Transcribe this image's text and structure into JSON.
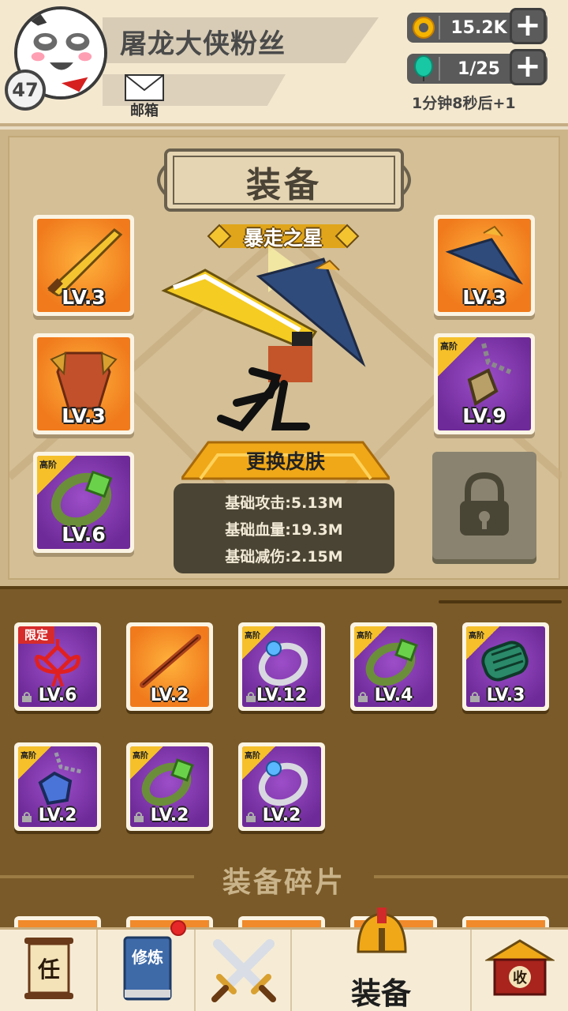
{
  "player": {
    "name": "屠龙大侠粉丝",
    "level": "47",
    "mail_label": "邮箱"
  },
  "resources": {
    "coins": "15.2K",
    "energy": "1/25",
    "energy_timer": "1分钟8秒后+1"
  },
  "equipment": {
    "title": "装备",
    "skin_name": "暴走之星",
    "change_skin_label": "更换皮肤",
    "slots": [
      {
        "item": "golden-sword",
        "level": "LV.3",
        "tier": ""
      },
      {
        "item": "straw-hat",
        "level": "LV.3",
        "tier": ""
      },
      {
        "item": "armor",
        "level": "LV.3",
        "tier": ""
      },
      {
        "item": "amulet",
        "level": "LV.9",
        "tier": "高阶"
      },
      {
        "item": "jade-ring",
        "level": "LV.6",
        "tier": "高阶"
      }
    ],
    "stats": [
      "基础攻击:5.13M",
      "基础血量:19.3M",
      "基础减伤:2.15M"
    ]
  },
  "inventory": {
    "items": [
      {
        "item": "chinese-knot",
        "level": "LV.6",
        "tag": "限定",
        "bg": "purple"
      },
      {
        "item": "staff",
        "level": "LV.2",
        "tag": "",
        "bg": "orange"
      },
      {
        "item": "silver-ring",
        "level": "LV.12",
        "tag": "高阶",
        "bg": "purple"
      },
      {
        "item": "jade-ring",
        "level": "LV.4",
        "tag": "高阶",
        "bg": "purple"
      },
      {
        "item": "jade-bracer",
        "level": "LV.3",
        "tag": "高阶",
        "bg": "purple"
      },
      {
        "item": "gem-amulet",
        "level": "LV.2",
        "tag": "高阶",
        "bg": "purple"
      },
      {
        "item": "jade-ring",
        "level": "LV.2",
        "tag": "高阶",
        "bg": "purple"
      },
      {
        "item": "silver-ring",
        "level": "LV.2",
        "tag": "高阶",
        "bg": "purple"
      }
    ],
    "fragments_title": "装备碎片"
  },
  "nav": {
    "task_glyph": "任",
    "cultivate_glyph": "修炼",
    "equipment_label": "装备",
    "collect_glyph": "收"
  },
  "colors": {
    "panel_bg": "#d4bf96",
    "inventory_bg": "#7a5a28",
    "orange_item_bg": "#f07a1c",
    "purple_item_bg": "#6e2a98",
    "tier_tag": "#f5c02a",
    "limited_tag": "#d72b2b"
  }
}
